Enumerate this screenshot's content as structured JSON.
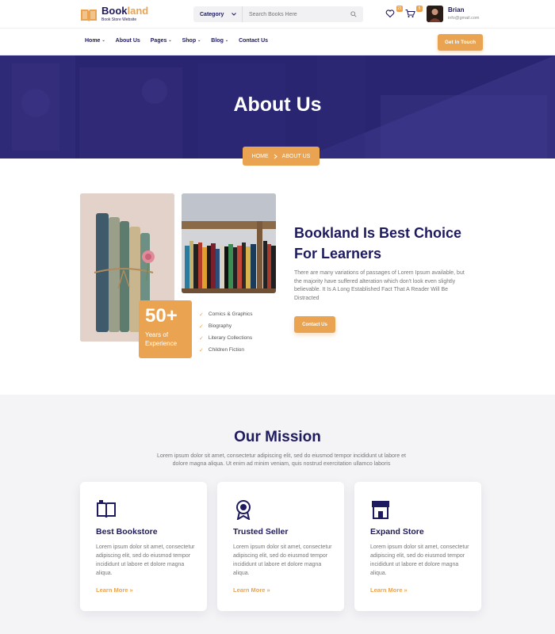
{
  "brand": {
    "name_part1": "Book",
    "name_part2": "land",
    "tagline": "Book Store Website",
    "accent": "#eaa451",
    "navy": "#1e1a5f"
  },
  "search": {
    "category": "Category",
    "placeholder": "Search Books Here"
  },
  "header": {
    "wishlist_count": "21",
    "cart_count": "5",
    "user_name": "Brian",
    "user_email": "info@gmail.com"
  },
  "nav": {
    "items": [
      "Home",
      "About Us",
      "Pages",
      "Shop",
      "Blog",
      "Contact Us"
    ],
    "dropdown_icons": [
      "chevron-down",
      "",
      "chevron-down",
      "chevron-down",
      "chevron-down",
      ""
    ],
    "cta": "Get In Touch"
  },
  "hero": {
    "title": "About Us",
    "breadcrumb_home": "HOME",
    "breadcrumb_current": "ABOUT US"
  },
  "about": {
    "experience_number": "50+",
    "experience_line1": "Years of",
    "experience_line2": "Experience",
    "features": [
      "Comics & Graphics",
      "Biography",
      "Literary Collections",
      "Children Fiction"
    ],
    "title_line1": "Bookland Is Best Choice",
    "title_line2": "For Learners",
    "text": "There are many variations of passages of Lorem Ipsum available, but the majority have suffered alteration which don't look even slightly believable. It Is A Long Established Fact That A Reader Will Be Distracted",
    "button": "Contact Us"
  },
  "mission": {
    "title": "Our Mission",
    "text": "Lorem ipsum dolor sit amet, consectetur adipiscing elit, sed do eiusmod tempor incididunt ut labore et dolore magna aliqua. Ut enim ad minim veniam, quis nostrud exercitation ullamco laboris",
    "cards": [
      {
        "icon": "book-icon",
        "title": "Best Bookstore",
        "text": "Lorem ipsum dolor sit amet, consectetur adipiscing elit, sed do eiusmod tempor incididunt ut labore et dolore magna aliqua.",
        "link": "Learn More"
      },
      {
        "icon": "award-icon",
        "title": "Trusted Seller",
        "text": "Lorem ipsum dolor sit amet, consectetur adipiscing elit, sed do eiusmod tempor incididunt ut labore et dolore magna aliqua.",
        "link": "Learn More"
      },
      {
        "icon": "store-icon",
        "title": "Expand Store",
        "text": "Lorem ipsum dolor sit amet, consectetur adipiscing elit, sed do eiusmod tempor incididunt ut labore et dolore magna aliqua.",
        "link": "Learn More"
      }
    ]
  }
}
